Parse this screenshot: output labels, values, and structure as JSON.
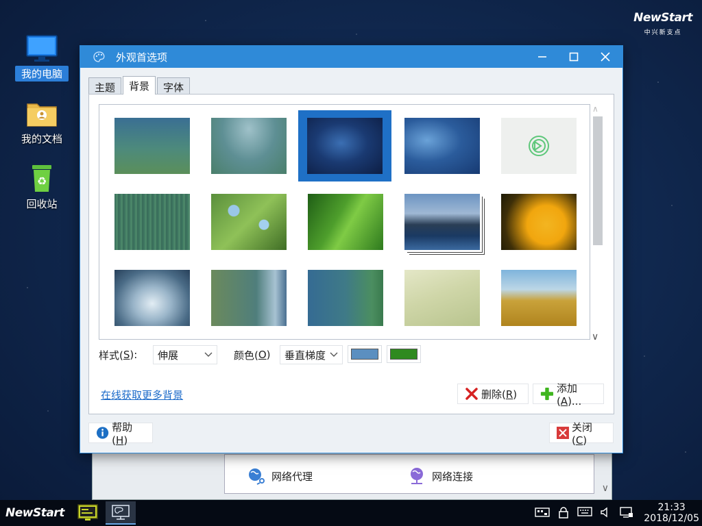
{
  "desktop": {
    "brand": {
      "logo": "NewStart",
      "subtitle": "中兴新支点"
    },
    "icons": [
      {
        "label": "我的电脑"
      },
      {
        "label": "我的文档"
      },
      {
        "label": "回收站"
      }
    ]
  },
  "background_window": {
    "items": [
      {
        "label": "网络代理"
      },
      {
        "label": "网络连接"
      }
    ]
  },
  "dialog": {
    "title": "外观首选项",
    "tabs": [
      {
        "label": "主题"
      },
      {
        "label": "背景"
      },
      {
        "label": "字体"
      }
    ],
    "active_tab": "背景",
    "style_label": "样式(",
    "style_key": "S",
    "style_suffix": "):",
    "style_value": "伸展",
    "color_label": "颜色(",
    "color_key": "O",
    "color_suffix": ")",
    "color_mode": "垂直梯度",
    "color1": "#5b8fc0",
    "color2": "#2f8a1f",
    "online_link": "在线获取更多背景",
    "delete_label": "删除(",
    "delete_key": "R",
    "delete_suffix": ")",
    "add_label": "添加(",
    "add_key": "A",
    "add_suffix": ")...",
    "help_label": "帮助(",
    "help_key": "H",
    "help_suffix": ")",
    "close_label": "关闭(",
    "close_key": "C",
    "close_suffix": ")"
  },
  "taskbar": {
    "logo": "NewStart",
    "time": "21:33",
    "date": "2018/12/05"
  }
}
